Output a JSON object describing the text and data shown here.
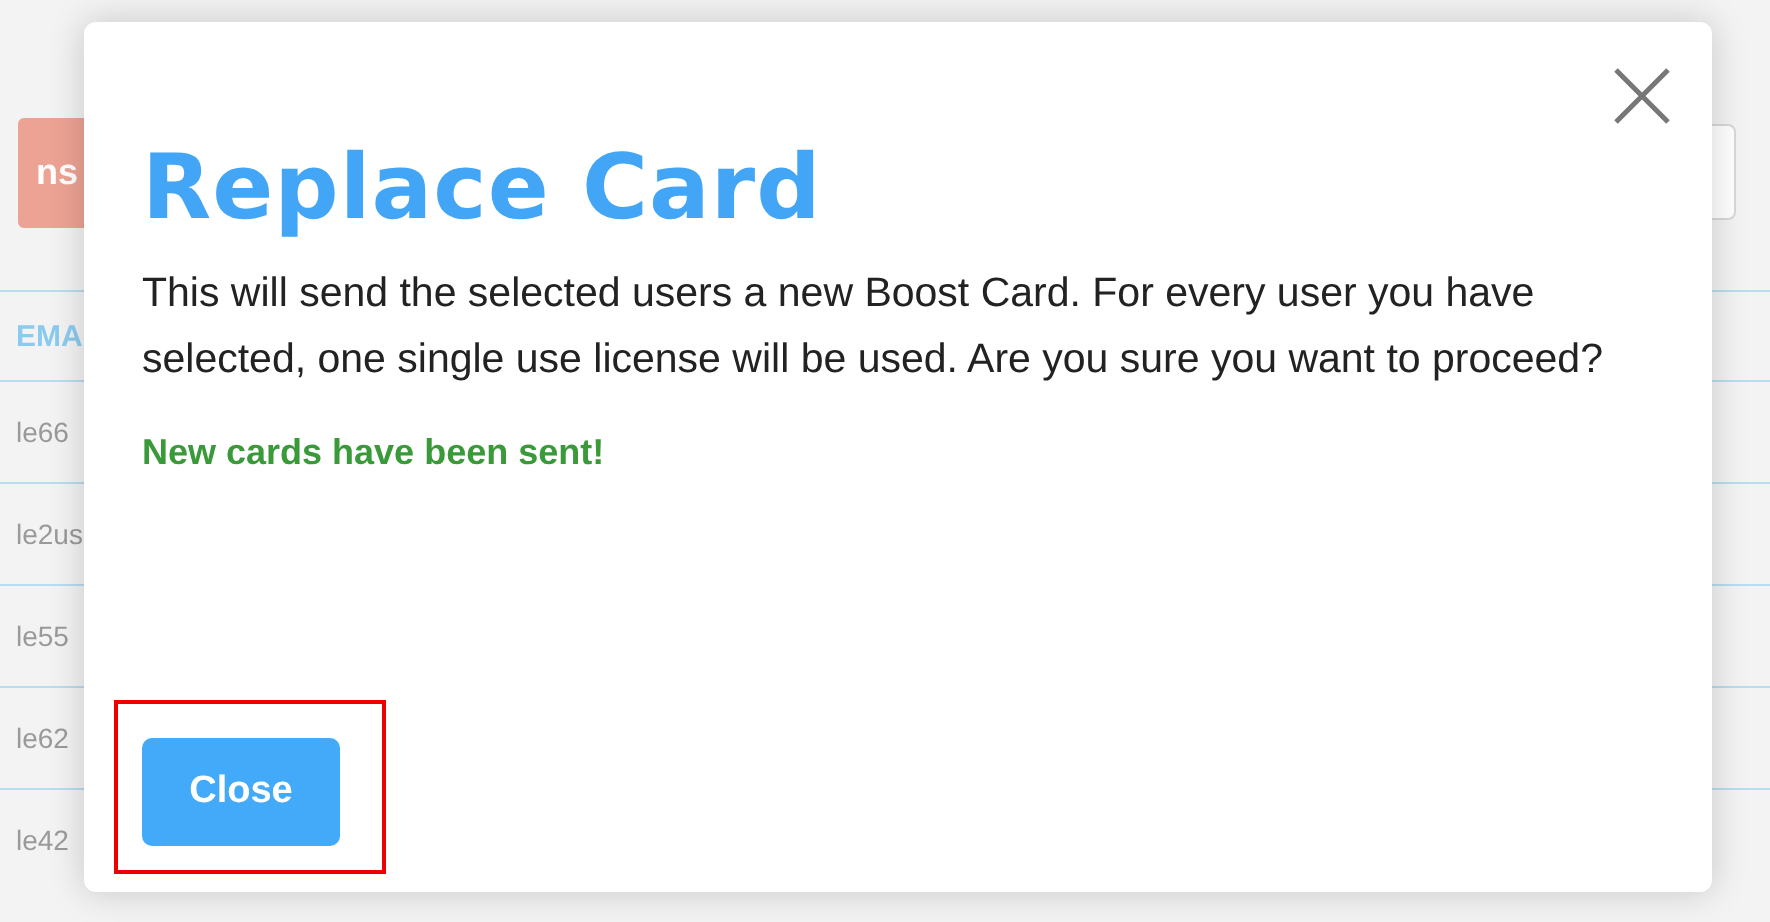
{
  "background": {
    "action_button": "ns",
    "column_header": "EMA",
    "rows": [
      "le66",
      "le2us",
      "le55",
      "le62",
      "le42"
    ]
  },
  "dialog": {
    "title": "Replace Card",
    "message": "This will send the selected users a new Boost Card. For every user you have selected, one single use license will be used. Are you sure you want to proceed?",
    "status": "New cards have been sent!",
    "close_button": "Close"
  }
}
